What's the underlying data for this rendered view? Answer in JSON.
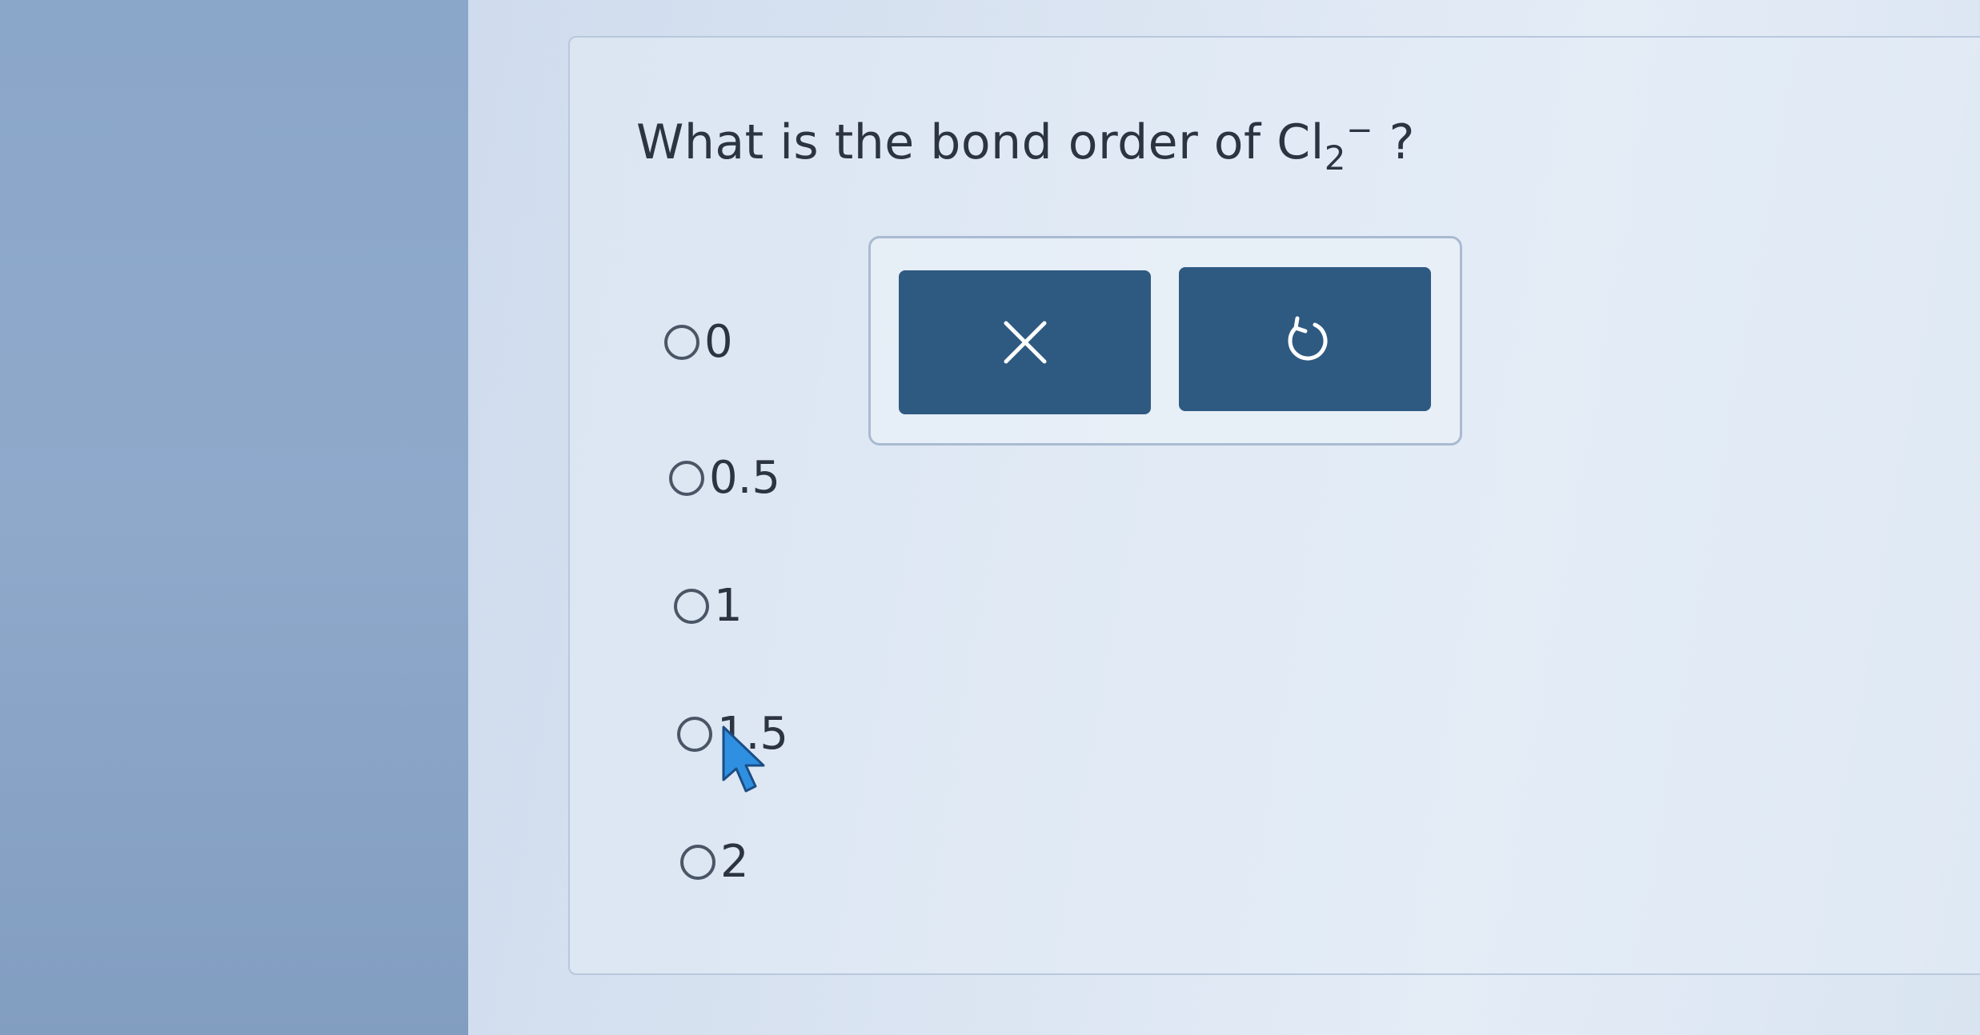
{
  "question": {
    "prefix": "What is the bond order of Cl",
    "subscript": "2",
    "superscript": "−",
    "suffix": "?"
  },
  "options": [
    {
      "label": "0"
    },
    {
      "label": "0.5"
    },
    {
      "label": "1"
    },
    {
      "label": "1.5"
    },
    {
      "label": "2"
    }
  ],
  "tools": {
    "clear_icon": "close-icon",
    "undo_icon": "undo-icon"
  },
  "colors": {
    "button": "#2e5a82",
    "text": "#2b3440",
    "cursor": "#2f8fe0"
  }
}
